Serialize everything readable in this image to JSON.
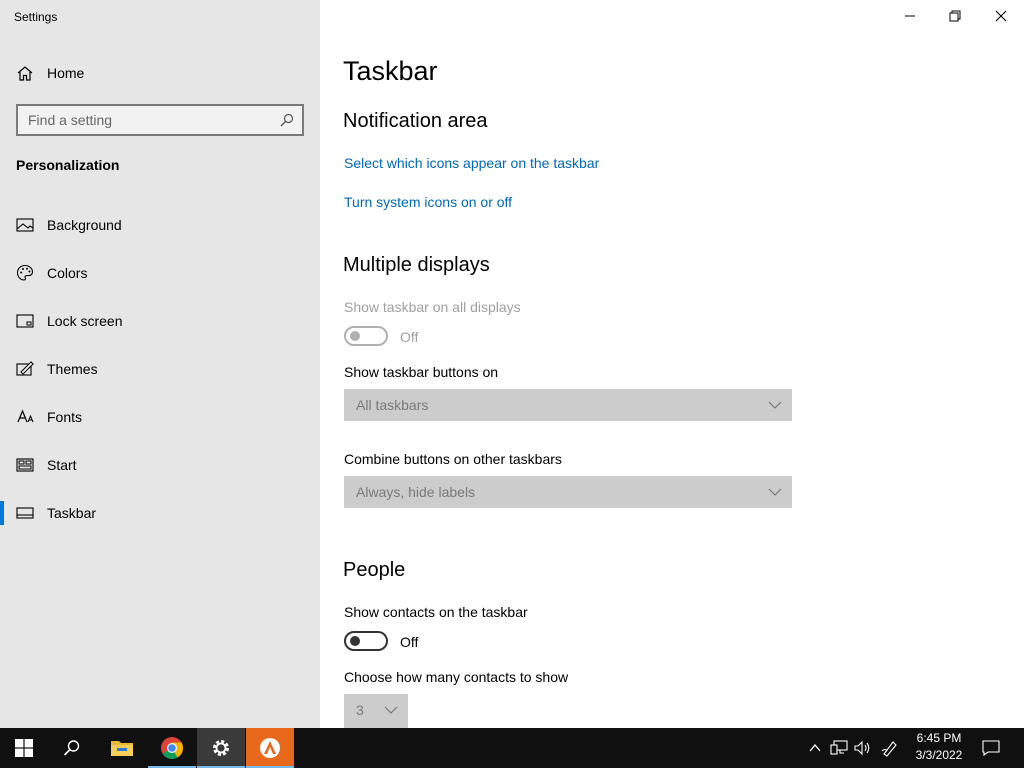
{
  "window": {
    "title": "Settings"
  },
  "sidebar": {
    "home_label": "Home",
    "search_placeholder": "Find a setting",
    "section": "Personalization",
    "items": [
      {
        "label": "Background",
        "icon": "picture-icon"
      },
      {
        "label": "Colors",
        "icon": "palette-icon"
      },
      {
        "label": "Lock screen",
        "icon": "lock-screen-icon"
      },
      {
        "label": "Themes",
        "icon": "themes-icon"
      },
      {
        "label": "Fonts",
        "icon": "fonts-icon"
      },
      {
        "label": "Start",
        "icon": "start-icon"
      },
      {
        "label": "Taskbar",
        "icon": "taskbar-icon",
        "selected": true
      }
    ]
  },
  "main": {
    "title": "Taskbar",
    "notification_area": {
      "heading": "Notification area",
      "link1": "Select which icons appear on the taskbar",
      "link2": "Turn system icons on or off"
    },
    "multiple_displays": {
      "heading": "Multiple displays",
      "show_all_label": "Show taskbar on all displays",
      "show_all_state": "Off",
      "buttons_on_label": "Show taskbar buttons on",
      "buttons_on_value": "All taskbars",
      "combine_label": "Combine buttons on other taskbars",
      "combine_value": "Always, hide labels"
    },
    "people": {
      "heading": "People",
      "show_contacts_label": "Show contacts on the taskbar",
      "show_contacts_state": "Off",
      "how_many_label": "Choose how many contacts to show",
      "how_many_value": "3"
    }
  },
  "taskbar": {
    "time": "6:45 PM",
    "date": "3/3/2022",
    "apps": [
      "start-icon",
      "search-icon",
      "file-explorer-icon",
      "chrome-icon",
      "settings-icon",
      "avast-icon"
    ]
  },
  "colors": {
    "accent": "#0078d7",
    "link": "#0067b8",
    "sidebar_bg": "#e6e6e6",
    "taskbar_bg": "#101010"
  }
}
